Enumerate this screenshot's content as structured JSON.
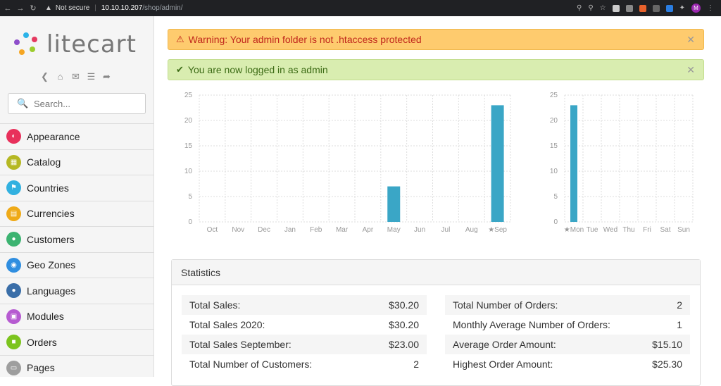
{
  "browser": {
    "security_label": "Not secure",
    "host": "10.10.10.207",
    "path": "/shop/admin/",
    "profile_initial": "M"
  },
  "sidebar": {
    "logo_text": "litecart",
    "search_placeholder": "Search...",
    "items": [
      {
        "label": "Appearance",
        "icon": "appearance-icon",
        "color": "#e8305b"
      },
      {
        "label": "Catalog",
        "icon": "catalog-icon",
        "color": "#b5b823"
      },
      {
        "label": "Countries",
        "icon": "countries-icon",
        "color": "#32b1e0"
      },
      {
        "label": "Currencies",
        "icon": "currencies-icon",
        "color": "#efaa18"
      },
      {
        "label": "Customers",
        "icon": "customers-icon",
        "color": "#3cb371"
      },
      {
        "label": "Geo Zones",
        "icon": "geo-zones-icon",
        "color": "#2f8ee0"
      },
      {
        "label": "Languages",
        "icon": "languages-icon",
        "color": "#3a6ea8"
      },
      {
        "label": "Modules",
        "icon": "modules-icon",
        "color": "#b65bd1"
      },
      {
        "label": "Orders",
        "icon": "orders-icon",
        "color": "#7cc41e"
      },
      {
        "label": "Pages",
        "icon": "pages-icon",
        "color": "#9e9e9e"
      }
    ]
  },
  "alerts": {
    "warning": "Warning: Your admin folder is not .htaccess protected",
    "success": "You are now logged in as admin"
  },
  "chart_data": [
    {
      "type": "bar",
      "categories": [
        "Oct",
        "Nov",
        "Dec",
        "Jan",
        "Feb",
        "Mar",
        "Apr",
        "May",
        "Jun",
        "Jul",
        "Aug",
        "★Sep"
      ],
      "values": [
        0,
        0,
        0,
        0,
        0,
        0,
        0,
        7,
        0,
        0,
        0,
        23
      ],
      "ylim": [
        0,
        25
      ],
      "yticks": [
        "0",
        "5",
        "10",
        "15",
        "20",
        "25"
      ],
      "color": "#3aa6c6"
    },
    {
      "type": "bar",
      "categories": [
        "★Mon",
        "Tue",
        "Wed",
        "Thu",
        "Fri",
        "Sat",
        "Sun"
      ],
      "values": [
        23,
        0,
        0,
        0,
        0,
        0,
        0
      ],
      "ylim": [
        0,
        25
      ],
      "yticks": [
        "0",
        "5",
        "10",
        "15",
        "20",
        "25"
      ],
      "color": "#3aa6c6"
    }
  ],
  "statistics": {
    "title": "Statistics",
    "left": [
      {
        "label": "Total Sales:",
        "value": "$30.20"
      },
      {
        "label": "Total Sales 2020:",
        "value": "$30.20"
      },
      {
        "label": "Total Sales September:",
        "value": "$23.00"
      },
      {
        "label": "Total Number of Customers:",
        "value": "2"
      }
    ],
    "right": [
      {
        "label": "Total Number of Orders:",
        "value": "2"
      },
      {
        "label": "Monthly Average Number of Orders:",
        "value": "1"
      },
      {
        "label": "Average Order Amount:",
        "value": "$15.10"
      },
      {
        "label": "Highest Order Amount:",
        "value": "$25.30"
      }
    ]
  }
}
